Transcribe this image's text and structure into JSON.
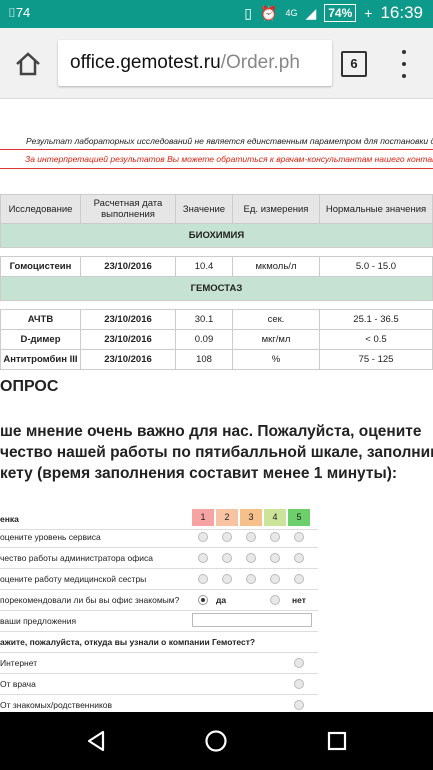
{
  "status_bar": {
    "left_badge": "74",
    "battery": "74%",
    "network": "4G",
    "time": "16:39"
  },
  "browser": {
    "url_host": "office.gemotest.ru",
    "url_path": "/Order.ph",
    "tab_count": "6"
  },
  "notices": {
    "disclaimer": "Результат лабораторных исследований не является единственным параметром для постановки диагн",
    "consult": "За интерпретацией результатов Вы можете обратиться к врачам-консультантам нашего контакт-цен"
  },
  "results": {
    "headers": [
      "Исследование",
      "Расчетная дата выполнения",
      "Значение",
      "Ед. измерения",
      "Нормальные значения"
    ],
    "groups": [
      {
        "name": "БИОХИМИЯ",
        "rows": [
          {
            "test": "Гомоцистеин",
            "date": "23/10/2016",
            "value": "10.4",
            "unit": "мкмоль/л",
            "norm": "5.0 - 15.0"
          }
        ]
      },
      {
        "name": "ГЕМОСТАЗ",
        "rows": [
          {
            "test": "АЧТВ",
            "date": "23/10/2016",
            "value": "30.1",
            "unit": "сек.",
            "norm": "25.1 - 36.5"
          },
          {
            "test": "D-димер",
            "date": "23/10/2016",
            "value": "0.09",
            "unit": "мкг/мл",
            "norm": "< 0.5"
          },
          {
            "test": "Антитромбин III",
            "date": "23/10/2016",
            "value": "108",
            "unit": "%",
            "norm": "75 - 125"
          }
        ]
      }
    ]
  },
  "poll": {
    "title": "ОПРОС",
    "intro_lines": [
      "ше мнение очень важно для нас. Пожалуйста, оцените",
      "чество нашей работы по пятибалльной шкале, заполнив эт",
      "кету (время заполнения составит менее 1 минуты):"
    ],
    "score_header": "енка",
    "scores": [
      "1",
      "2",
      "3",
      "4",
      "5"
    ],
    "score_colors": [
      "#f5a3a3",
      "#f7c3a3",
      "#f6c08a",
      "#cbe49a",
      "#6ccf6c"
    ],
    "ratings": [
      "оцените уровень сервиса",
      "чество работы администратора офиса",
      "оцените работу медицинской сестры"
    ],
    "recommend": {
      "question": "порекомендовали ли бы вы офис знакомым?",
      "yes": "да",
      "no": "нет",
      "selected": "да"
    },
    "suggestions_label": "ваши предложения",
    "source_question": "ажите, пожалуйста, откуда вы узнали о компании Гемотест?",
    "sources": [
      "Интернет",
      "От врача",
      "От знакомых/родственников"
    ]
  }
}
